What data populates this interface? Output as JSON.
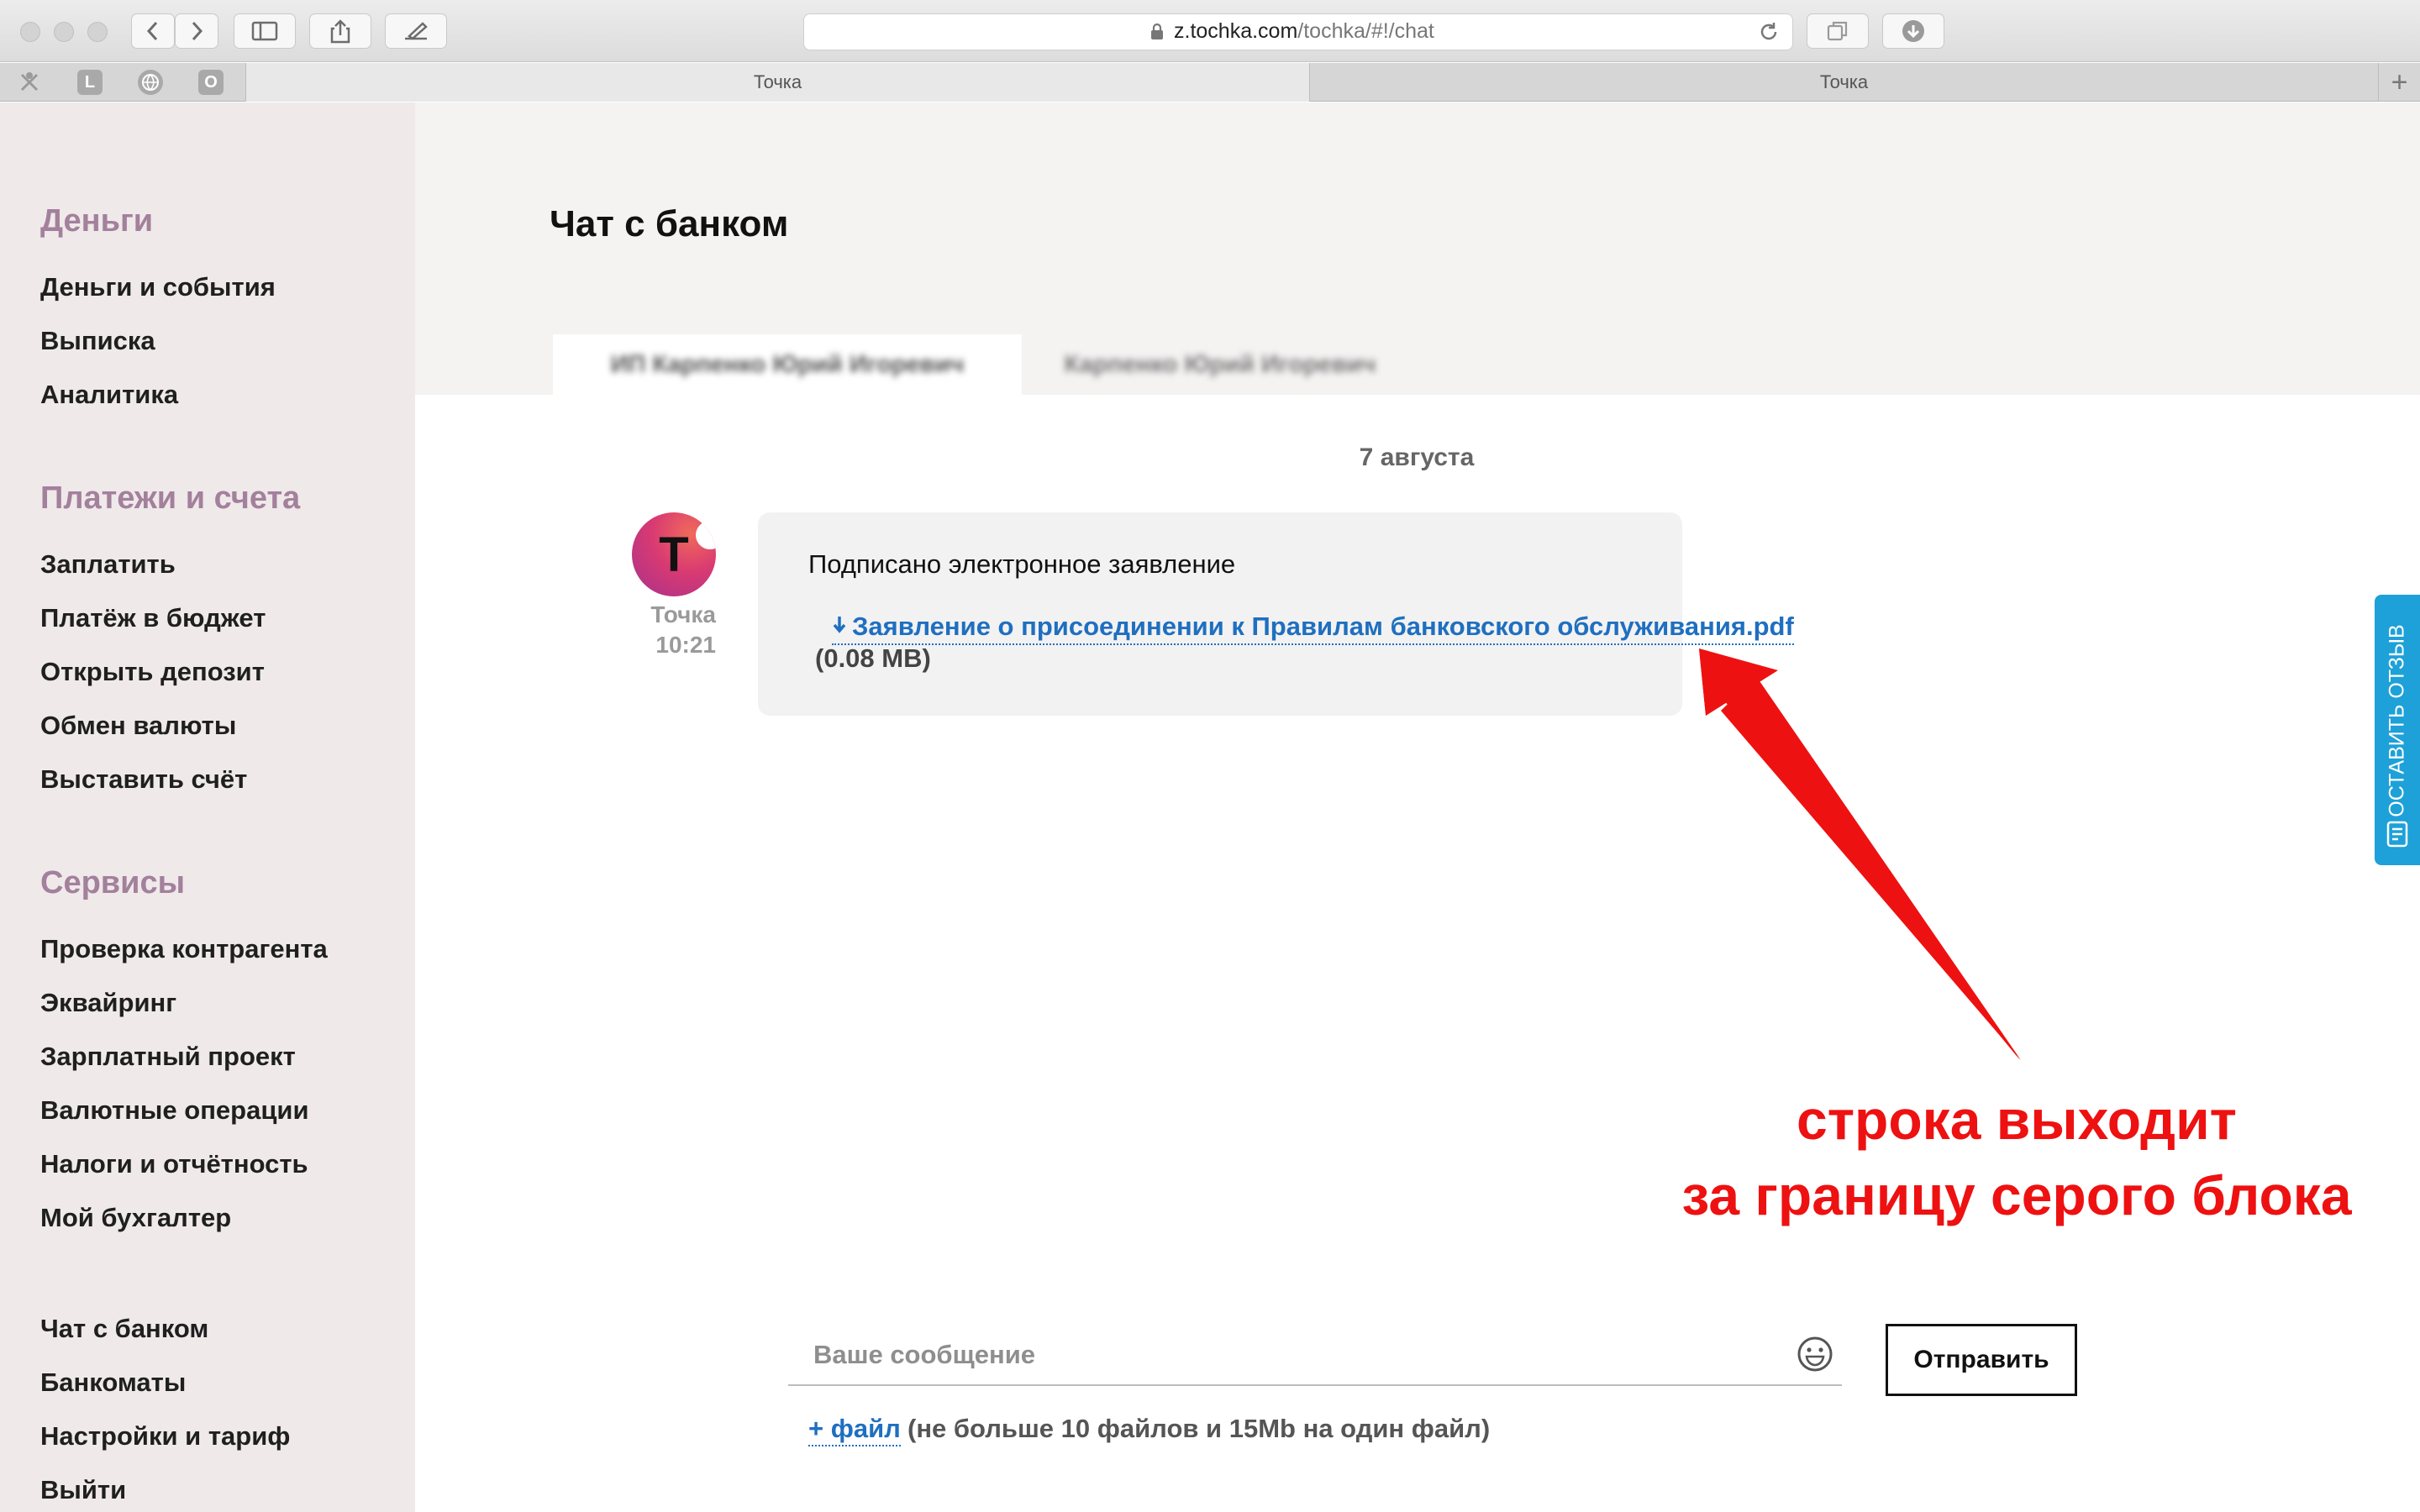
{
  "browser": {
    "url_domain": "z.tochka.com",
    "url_path": "/tochka/#!/chat",
    "favicons": [
      "L",
      "O"
    ],
    "tabs": [
      {
        "label": "Точка",
        "active": true
      },
      {
        "label": "Точка",
        "active": false
      }
    ],
    "new_tab_label": "+"
  },
  "sidebar": {
    "sections": [
      {
        "heading": "Деньги",
        "items": [
          "Деньги и события",
          "Выписка",
          "Аналитика"
        ]
      },
      {
        "heading": "Платежи и счета",
        "items": [
          "Заплатить",
          "Платёж в бюджет",
          "Открыть депозит",
          "Обмен валюты",
          "Выставить счёт"
        ]
      },
      {
        "heading": "Сервисы",
        "items": [
          "Проверка контрагента",
          "Эквайринг",
          "Зарплатный проект",
          "Валютные операции",
          "Налоги и отчётность",
          "Мой бухгалтер"
        ]
      }
    ],
    "bottom_items": [
      "Чат с банком",
      "Банкоматы",
      "Настройки и тариф",
      "Выйти"
    ]
  },
  "main": {
    "title": "Чат с банком",
    "chat_tabs": [
      {
        "label": "ИП Карпенко Юрий Игоревич",
        "active": true
      },
      {
        "label": "Карпенко Юрий Игоревич",
        "active": false
      }
    ],
    "date_divider": "7 августа",
    "message": {
      "avatar_letter": "T",
      "sender": "Точка",
      "time": "10:21",
      "text": "Подписано электронное заявление",
      "file_name": "Заявление о присоединении к Правилам банковского обслуживания.pdf",
      "file_size": "(0.08 MB)"
    },
    "composer": {
      "placeholder": "Ваше сообщение",
      "send_label": "Отправить",
      "attach_label": "+ файл",
      "attach_hint": "(не больше 10 файлов и 15Mb на один файл)"
    }
  },
  "feedback_tab": {
    "label": "ОСТАВИТЬ ОТЗЫВ"
  },
  "annotation": {
    "line1": "строка выходит",
    "line2": "за границу серого блока",
    "color": "#ee1111"
  }
}
